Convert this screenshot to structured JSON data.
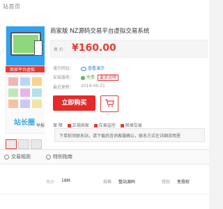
{
  "breadcrumb": "站首页",
  "product": {
    "title": "商家版 NZ源码交易平台虚拟交易系统",
    "price_label": "售 价",
    "price": "¥160.00",
    "image_watermark": "站长圈",
    "image_banner": "商家平台虚拟"
  },
  "info": {
    "demo_label": "演示网址：",
    "demo_value": "查看演示",
    "security_label": "安装服务：",
    "security_value": "免费",
    "security_tag": "要求说明",
    "time_label": "最近更新：",
    "time_value": "2019-06-21"
  },
  "actions": {
    "buy_label": "立即购买",
    "cart_label": "购物车"
  },
  "guarantee": {
    "label": "保 障",
    "items": [
      "正规商家",
      "交易监控",
      "担保交易"
    ]
  },
  "side": {
    "report": "举报"
  },
  "note": "下单前须联系站，请下载后咨询客服确认，联系方式在详细说明里",
  "tabs": [
    "交易规则",
    "特别指南"
  ],
  "attributes": {
    "size_label": "大小",
    "size_value": "18M",
    "type_label": "规格",
    "type_value": "整站源码",
    "right_label": "授权",
    "right_value": "免授权"
  },
  "bottom_fragment": "i"
}
